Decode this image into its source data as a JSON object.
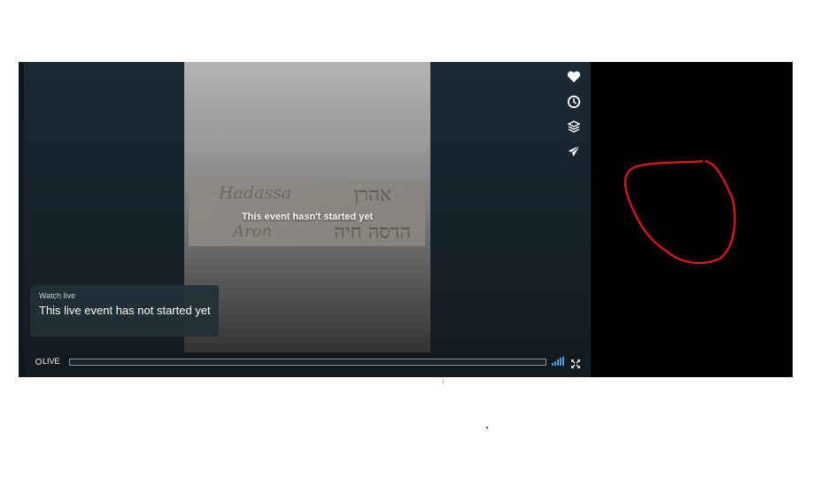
{
  "player": {
    "notice": "This event hasn't started yet",
    "poster_card": {
      "name_line_1": "Hadassa",
      "name_line_2": "Aron",
      "hebrew_line_1": "אהרן",
      "hebrew_line_2": "הדסה חיה"
    },
    "info_box": {
      "small_label": "Watch live",
      "title": "This live event has not started yet"
    },
    "side_icons": [
      "heart-icon",
      "clock-icon",
      "layers-icon",
      "send-icon"
    ],
    "controls": {
      "live_label": "LIVE",
      "progress_fraction": 0,
      "icons": [
        "volume-bars-icon",
        "fullscreen-icon"
      ]
    }
  },
  "colors": {
    "annotation_red": "#e8151b",
    "volume_blue": "#3fa0de",
    "panel_black": "#000000"
  }
}
